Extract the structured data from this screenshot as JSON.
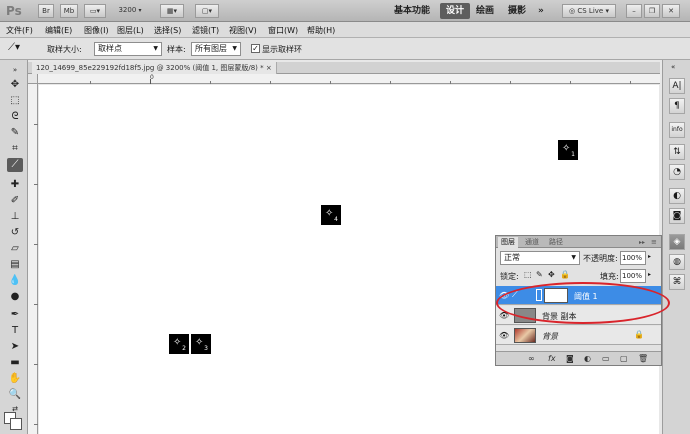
{
  "app": {
    "logo": "Ps"
  },
  "topbar": {
    "btn_br": "Br",
    "btn_mb": "Mb",
    "zoom": "3200",
    "workspaces": [
      "基本功能",
      "设计",
      "绘画",
      "摄影"
    ],
    "active_workspace": "设计",
    "more": "»",
    "cs_live": "CS Live"
  },
  "menu": [
    "文件(F)",
    "编辑(E)",
    "图像(I)",
    "图层(L)",
    "选择(S)",
    "滤镜(T)",
    "视图(V)",
    "窗口(W)",
    "帮助(H)"
  ],
  "options": {
    "sample_size_label": "取样大小:",
    "sample_size_value": "取样点",
    "sample_label": "样本:",
    "sample_value": "所有图层",
    "show_ring_label": "显示取样环",
    "show_ring_checked": true
  },
  "document": {
    "tab_title": "120_14699_85e229192fd18f5.jpg @ 3200% (阈值 1, 图层蒙版/8) *",
    "close": "×",
    "ruler_mark": "0"
  },
  "color_samplers": [
    {
      "label": "1"
    },
    {
      "label": "2"
    },
    {
      "label": "3"
    },
    {
      "label": "4"
    }
  ],
  "layers_panel": {
    "tabs": [
      "图层",
      "通道",
      "路径"
    ],
    "active_tab": "图层",
    "blend_mode": "正常",
    "opacity_label": "不透明度:",
    "opacity_value": "100%",
    "lock_label": "锁定:",
    "fill_label": "填充:",
    "fill_value": "100%",
    "layers": [
      {
        "name": "阈值 1",
        "selected": true
      },
      {
        "name": "背景 副本",
        "selected": false
      },
      {
        "name": "背景",
        "selected": false
      }
    ]
  },
  "highlight_color": "#d9242b",
  "selection_color": "#3d8ce6"
}
